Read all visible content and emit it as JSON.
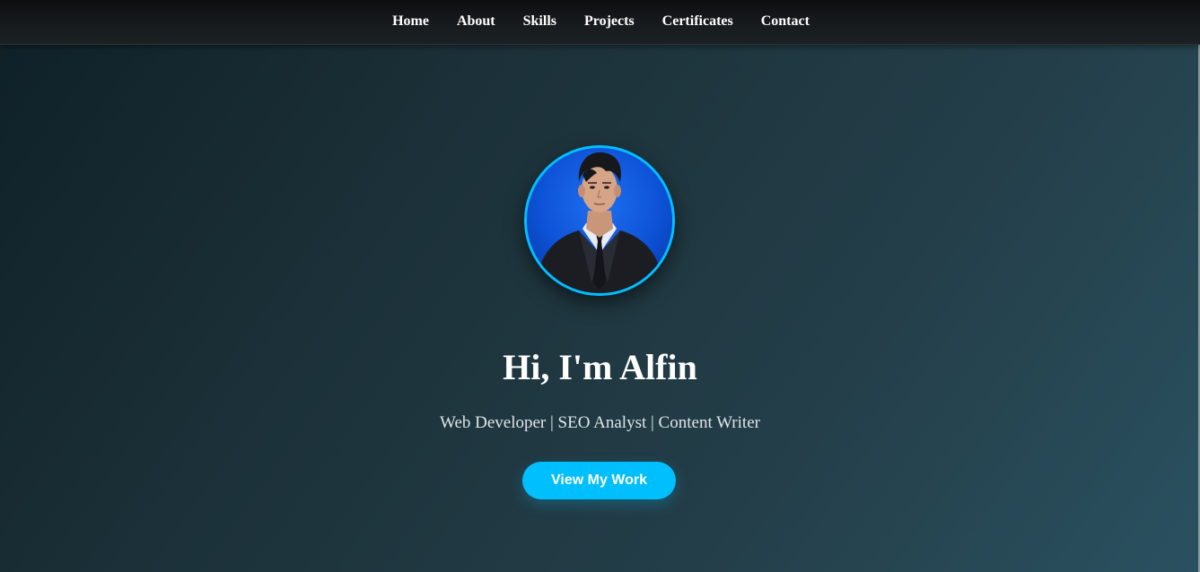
{
  "nav": {
    "items": [
      {
        "label": "Home"
      },
      {
        "label": "About"
      },
      {
        "label": "Skills"
      },
      {
        "label": "Projects"
      },
      {
        "label": "Certificates"
      },
      {
        "label": "Contact"
      }
    ]
  },
  "hero": {
    "title": "Hi, I'm Alfin",
    "subtitle": "Web Developer | SEO Analyst | Content Writer",
    "cta_label": "View My Work",
    "avatar_icon": "profile-photo"
  },
  "colors": {
    "accent": "#00bfff",
    "background_start": "#0f2027",
    "background_end": "#2a5160",
    "navbar": "#16191b",
    "text": "#ffffff"
  }
}
